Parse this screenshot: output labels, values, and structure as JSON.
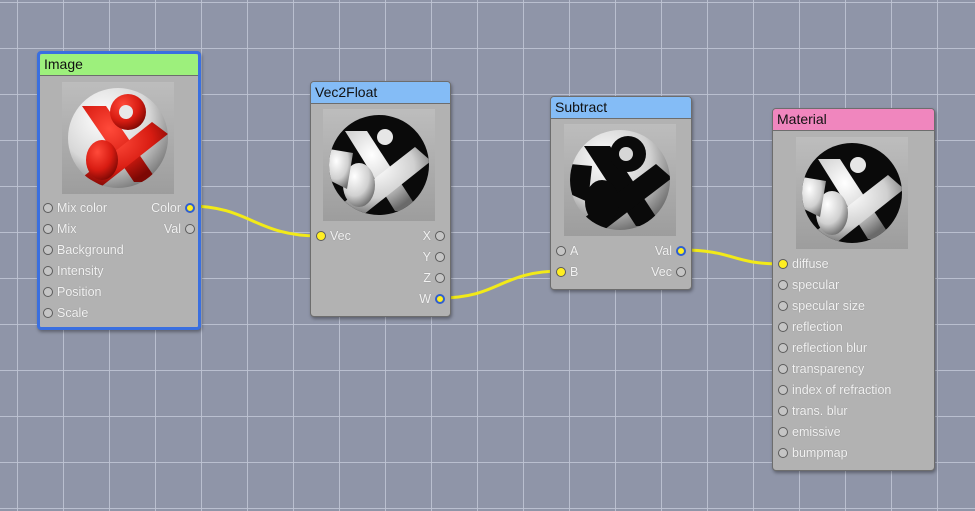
{
  "colors": {
    "canvas": "#8f95a8",
    "wire": "#f2ea18",
    "image_header": "#9df07c",
    "vec2float_header": "#84bcf6",
    "subtract_header": "#84bcf6",
    "material_header": "#f086be",
    "selection_border": "#3a6fe0"
  },
  "nodes": {
    "image": {
      "title": "Image",
      "preview_icon": "sphere-red-ampersand",
      "inputs": [
        "Mix color",
        "Mix",
        "Background",
        "Intensity",
        "Position",
        "Scale"
      ],
      "outputs": [
        "Color",
        "Val"
      ],
      "selected": true
    },
    "vec2float": {
      "title": "Vec2Float",
      "preview_icon": "sphere-bw-ampersand",
      "inputs": [
        "Vec"
      ],
      "outputs": [
        "X",
        "Y",
        "Z",
        "W"
      ]
    },
    "subtract": {
      "title": "Subtract",
      "preview_icon": "sphere-bw-ampersand-dark",
      "inputs": [
        "A",
        "B"
      ],
      "outputs": [
        "Val",
        "Vec"
      ]
    },
    "material": {
      "title": "Material",
      "preview_icon": "sphere-bw-ampersand",
      "inputs": [
        "diffuse",
        "specular",
        "specular size",
        "reflection",
        "reflection blur",
        "transparency",
        "index of refraction",
        "trans. blur",
        "emissive",
        "bumpmap"
      ]
    }
  },
  "connections": [
    {
      "from": "Image.Color",
      "to": "Vec2Float.Vec"
    },
    {
      "from": "Vec2Float.W",
      "to": "Subtract.B"
    },
    {
      "from": "Subtract.Val",
      "to": "Material.diffuse"
    }
  ]
}
